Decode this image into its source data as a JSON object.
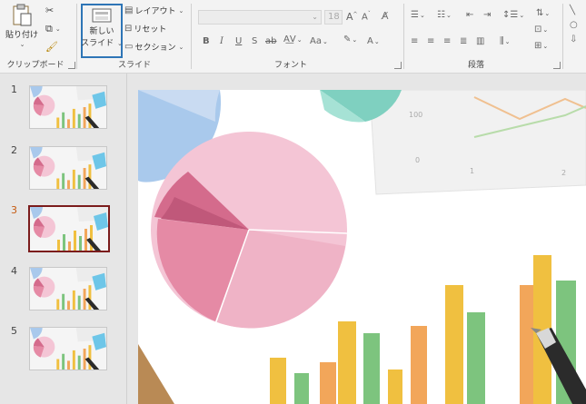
{
  "ribbon": {
    "clipboard": {
      "paste_label": "貼り付け",
      "group_label": "クリップボード"
    },
    "slides": {
      "new_slide_line1": "新しい",
      "new_slide_line2": "スライド",
      "layout_label": "レイアウト",
      "reset_label": "リセット",
      "section_label": "セクション",
      "group_label": "スライド"
    },
    "font": {
      "font_name": "",
      "font_size": "18",
      "group_label": "フォント"
    },
    "paragraph": {
      "group_label": "段落"
    }
  },
  "thumbnails": [
    {
      "number": "1",
      "active": false
    },
    {
      "number": "2",
      "active": false
    },
    {
      "number": "3",
      "active": true
    },
    {
      "number": "4",
      "active": false
    },
    {
      "number": "5",
      "active": false
    }
  ],
  "slide_image": {
    "paper_axis_values": [
      "100",
      "0",
      "1",
      "2"
    ]
  },
  "colors": {
    "accent_active_number": "#c55a11",
    "active_thumb_border": "#7b1c1c",
    "new_slide_highlight": "#2e75b6"
  }
}
